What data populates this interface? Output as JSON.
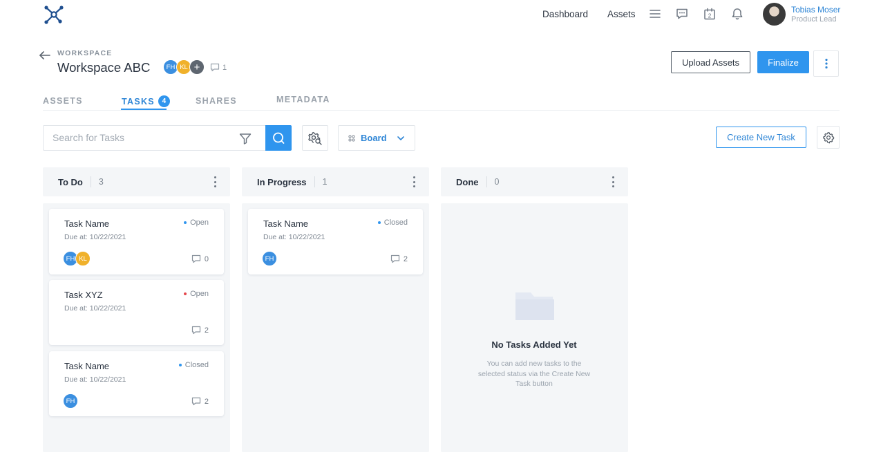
{
  "topbar": {
    "nav": [
      "Dashboard",
      "Assets"
    ],
    "icons": [
      "menu-icon",
      "chat-icon",
      "calendar-icon",
      "bell-icon"
    ],
    "calendar_day": "2",
    "user": {
      "name": "Tobias Moser",
      "role": "Product Lead"
    }
  },
  "workspace": {
    "label": "WORKSPACE",
    "title": "Workspace ABC",
    "members": [
      "FH",
      "KL"
    ],
    "add_member": "+",
    "comment_count": "1",
    "upload_label": "Upload Assets",
    "finalize_label": "Finalize"
  },
  "tabs": [
    {
      "label": "ASSETS",
      "active": false
    },
    {
      "label": "TASKS",
      "active": true,
      "badge": "4"
    },
    {
      "label": "SHARES",
      "active": false
    },
    {
      "label": "METADATA",
      "active": false
    }
  ],
  "toolbar": {
    "search_placeholder": "Search for Tasks",
    "view_label": "Board",
    "create_label": "Create New Task"
  },
  "columns": [
    {
      "title": "To Do",
      "count": "3",
      "cards": [
        {
          "name": "Task Name",
          "due": "Due at: 10/22/2021",
          "status": "Open",
          "status_color": "#2f95ee",
          "assignees": [
            "FH",
            "KL"
          ],
          "comments": "0"
        },
        {
          "name": "Task XYZ",
          "due": "Due at: 10/22/2021",
          "status": "Open",
          "status_color": "#e5484d",
          "assignees": [],
          "comments": "2"
        },
        {
          "name": "Task Name",
          "due": "Due at: 10/22/2021",
          "status": "Closed",
          "status_color": "#2f95ee",
          "assignees": [
            "FH"
          ],
          "comments": "2"
        }
      ]
    },
    {
      "title": "In Progress",
      "count": "1",
      "cards": [
        {
          "name": "Task Name",
          "due": "Due at: 10/22/2021",
          "status": "Closed",
          "status_color": "#2f95ee",
          "assignees": [
            "FH"
          ],
          "comments": "2"
        }
      ]
    },
    {
      "title": "Done",
      "count": "0",
      "cards": [],
      "empty_title": "No Tasks Added Yet",
      "empty_desc": "You can add new tasks to the selected status via the Create New Task button"
    }
  ],
  "colors": {
    "accent": "#2f95ee",
    "chip_blue": "#3b8fe0",
    "chip_yellow": "#f0b12b",
    "column_bg": "#f4f6f8"
  }
}
